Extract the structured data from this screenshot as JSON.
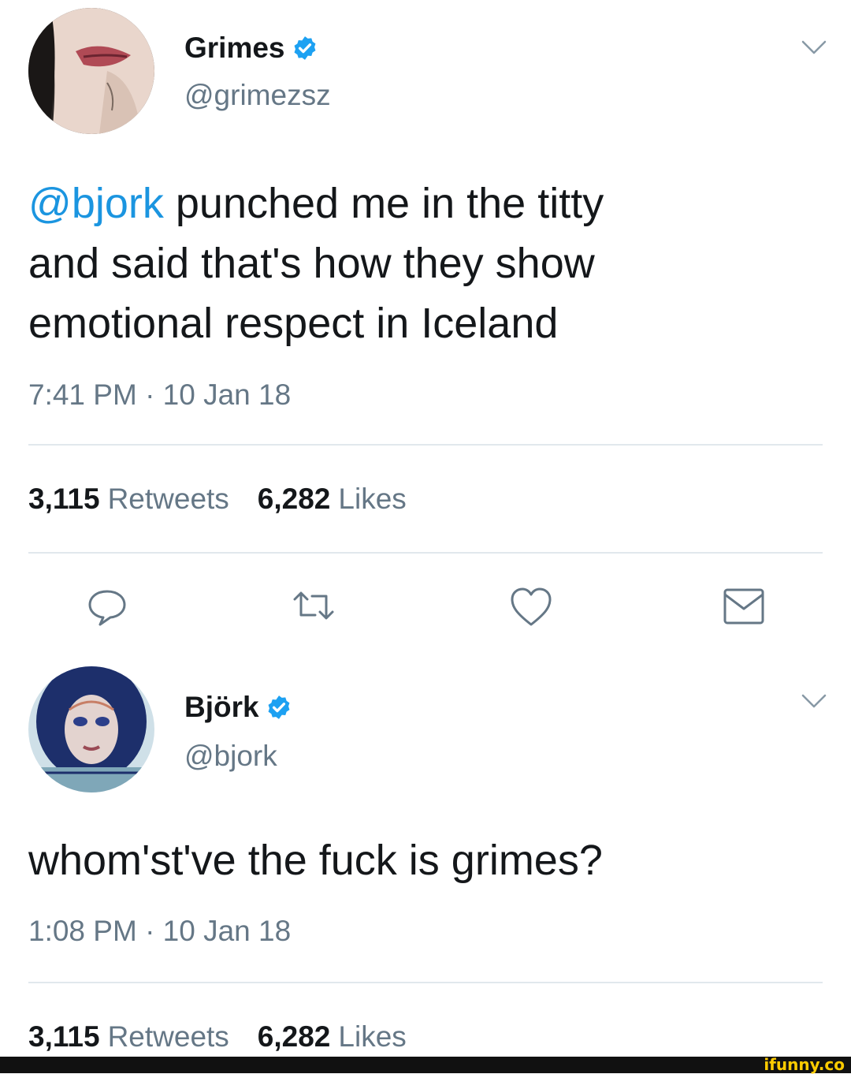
{
  "tweet1": {
    "name": "Grimes",
    "handle": "@grimezsz",
    "mention": "@bjork",
    "text_line1_rest": " punched me in the titty",
    "text_line2": "and said that's how they show",
    "text_line3": "emotional respect in Iceland",
    "time": "7:41 PM · 10 Jan 18",
    "retweets_count": "3,115",
    "retweets_label": "Retweets",
    "likes_count": "6,282",
    "likes_label": "Likes",
    "avatar_icon": "grimes-avatar"
  },
  "actions": {
    "reply_icon": "reply-icon",
    "retweet_icon": "retweet-icon",
    "like_icon": "heart-icon",
    "message_icon": "envelope-icon"
  },
  "tweet2": {
    "name": "Björk",
    "handle": "@bjork",
    "text": "whom'st've the fuck is grimes?",
    "time": "1:08 PM · 10 Jan 18",
    "retweets_count": "3,115",
    "retweets_label": "Retweets",
    "likes_count": "6,282",
    "likes_label": "Likes",
    "avatar_icon": "bjork-avatar"
  },
  "colors": {
    "verified": "#1da1f2",
    "mention": "#1b95e0",
    "secondary_text": "#657786",
    "divider": "#e1e8ed"
  },
  "watermark": "ifunny.co"
}
